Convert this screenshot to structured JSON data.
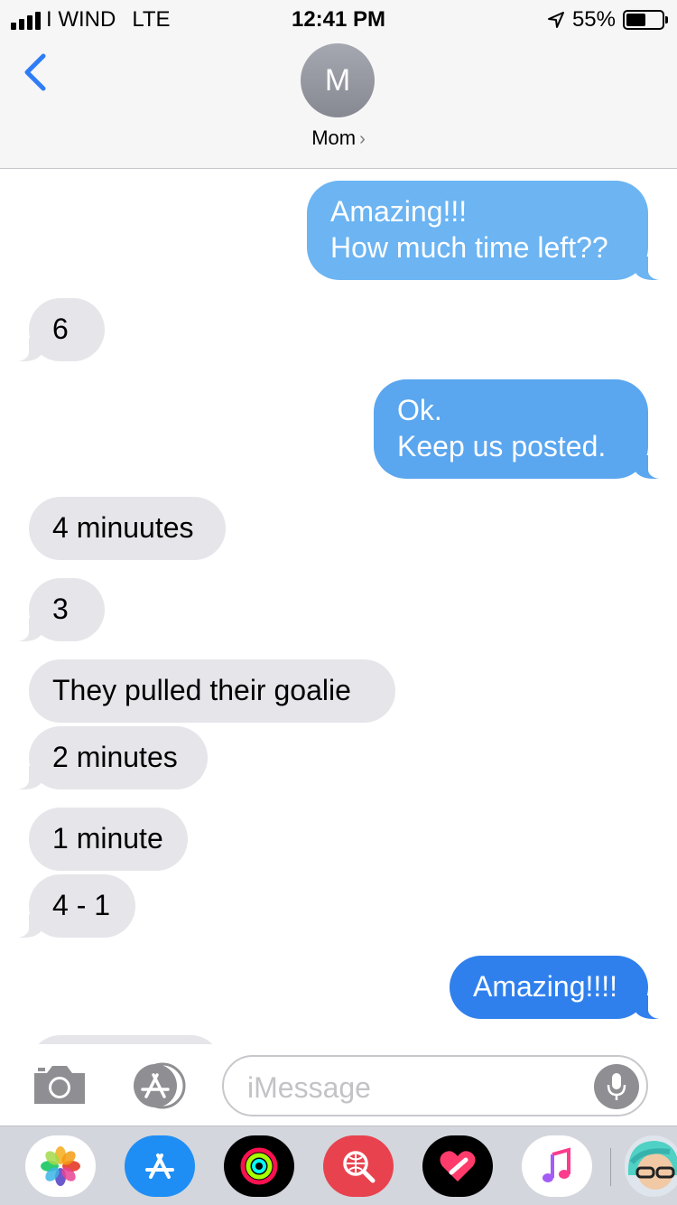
{
  "status_bar": {
    "carrier": "I WIND",
    "network": "LTE",
    "time": "12:41 PM",
    "battery_percent": "55%",
    "battery_level": 0.55
  },
  "header": {
    "avatar_initial": "M",
    "contact_name": "Mom",
    "contact_chevron": "›"
  },
  "messages": [
    {
      "from": "me",
      "lines": [
        "Amazing!!!",
        "How much time left??"
      ]
    },
    {
      "from": "them",
      "lines": [
        "6"
      ]
    },
    {
      "from": "me",
      "lines": [
        "Ok.",
        "Keep us posted."
      ]
    },
    {
      "from": "them",
      "lines": [
        "4 minuutes"
      ]
    },
    {
      "from": "them",
      "lines": [
        "3"
      ]
    },
    {
      "from": "them",
      "lines": [
        "They pulled their goalie"
      ]
    },
    {
      "from": "them",
      "lines": [
        "2 minutes"
      ]
    },
    {
      "from": "them",
      "lines": [
        "1 minute"
      ]
    },
    {
      "from": "them",
      "lines": [
        "4 - 1"
      ]
    },
    {
      "from": "me",
      "lines": [
        "Amazing!!!!"
      ]
    }
  ],
  "input": {
    "placeholder": "iMessage"
  },
  "app_drawer": {
    "apps": [
      "photos-app-icon",
      "app-store-icon",
      "activity-icon",
      "search-images-icon",
      "digital-touch-icon",
      "music-icon",
      "memoji-icon"
    ]
  },
  "colors": {
    "bubble_in": "#e5e5ea",
    "bubble_out_light": "#6cb4f2",
    "bubble_out_mid": "#5aa6ef",
    "bubble_out_dark": "#2f80ed",
    "accent": "#2f7df6"
  }
}
